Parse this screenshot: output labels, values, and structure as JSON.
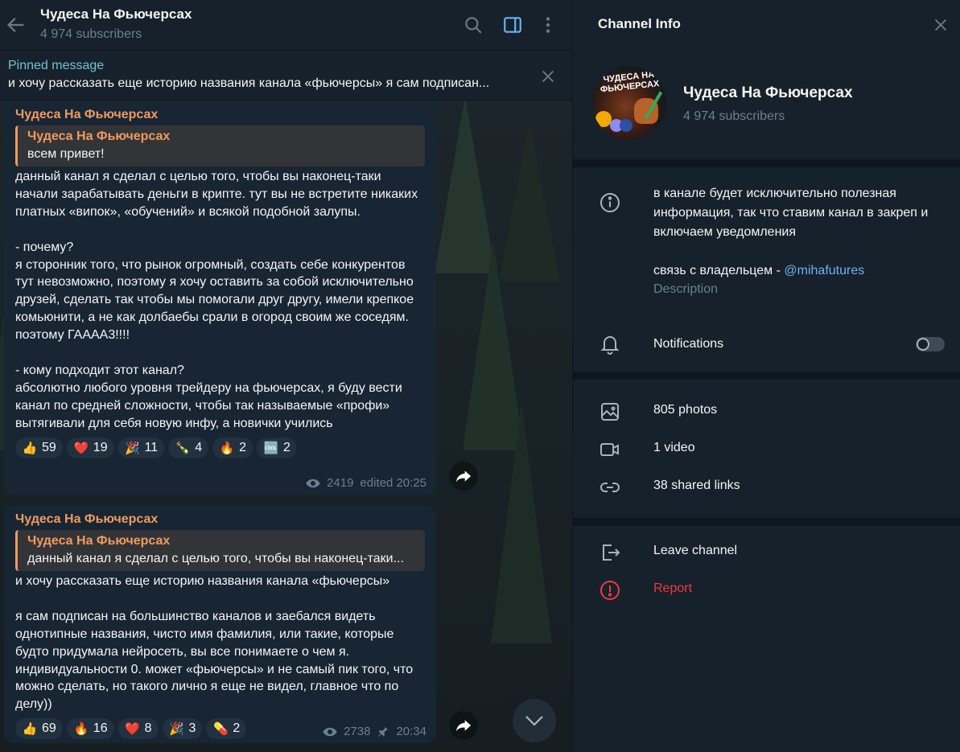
{
  "header": {
    "title": "Чудеса На Фьючерсах",
    "subtitle": "4 974 subscribers"
  },
  "pinned": {
    "label": "Pinned message",
    "text": "и хочу рассказать еще историю названия канала «фьючерсы»  я сам подписан..."
  },
  "messages": [
    {
      "author": "Чудеса На Фьючерсах",
      "reply_author": "Чудеса На Фьючерсах",
      "reply_text": "всем привет!",
      "text": "данный канал я сделал с целью того, чтобы вы наконец-таки начали зарабатывать деньги в крипте. тут вы не встретите никаких платных «випок», «обучений» и всякой подобной залупы.\n\n- почему?\nя сторонник того, что рынок огромный, создать себе конкурентов тут невозможно, поэтому я хочу оставить за собой исключительно друзей, сделать так чтобы мы помогали друг другу, имели крепкое комьюнити, а не как долбаебы срали в огород своим же соседям. поэтому ГАААА3!!!!\n\n- кому подходит этот канал?\nабсолютно любого уровня трейдеру на фьючерсах, я буду вести канал по средней сложности, чтобы так называемые «профи» вытягивали для себя новую инфу, а новички учились",
      "reactions": [
        {
          "emoji": "👍",
          "count": "59"
        },
        {
          "emoji": "❤️",
          "count": "19"
        },
        {
          "emoji": "🎉",
          "count": "11"
        },
        {
          "emoji": "🍾",
          "count": "4"
        },
        {
          "emoji": "🔥",
          "count": "2"
        },
        {
          "emoji": "🆒",
          "count": "2"
        }
      ],
      "views": "2419",
      "time": "edited 20:25"
    },
    {
      "author": "Чудеса На Фьючерсах",
      "reply_author": "Чудеса На Фьючерсах",
      "reply_text": "данный канал я сделал с целью того, чтобы вы наконец-таки...",
      "text": "и хочу рассказать еще историю названия канала «фьючерсы»\n\nя сам подписан на большинство каналов и заебался видеть однотипные названия, чисто имя фамилия, или такие, которые будто придумала нейросеть, вы все понимаете о чем я. индивидуальности 0. может «фьючерсы» и не самый пик того, что можно сделать, но такого лично я еще не видел, главное что по делу))",
      "reactions": [
        {
          "emoji": "👍",
          "count": "69"
        },
        {
          "emoji": "🔥",
          "count": "16"
        },
        {
          "emoji": "❤️",
          "count": "8"
        },
        {
          "emoji": "🎉",
          "count": "3"
        },
        {
          "emoji": "💊",
          "count": "2"
        }
      ],
      "views": "2738",
      "time": "20:34"
    }
  ],
  "info": {
    "panel_title": "Channel Info",
    "channel_name": "Чудеса На Фьючерсах",
    "subscribers": "4 974 subscribers",
    "avatar_text": "ЧУДЕСА НА ФЬЮЧЕРСАХ",
    "description_main": "в канале будет исключительно полезная информация, так что ставим канал в закреп и включаем уведомления",
    "description_contact_prefix": "связь с владельцем - ",
    "description_contact_link": "@mihafutures",
    "description_label": "Description",
    "notifications_label": "Notifications",
    "notifications_on": false,
    "photos": "805 photos",
    "videos": "1 video",
    "links": "38 shared links",
    "leave": "Leave channel",
    "report": "Report"
  },
  "colors": {
    "accent": "#6ab3f3",
    "author": "#f09a5e",
    "danger": "#ec3942",
    "panel_bg": "#17212b",
    "bubble_bg": "#182533"
  },
  "icons": [
    "back-arrow-icon",
    "search-icon",
    "sidebar-toggle-icon",
    "more-vertical-icon",
    "close-icon",
    "forward-icon",
    "chevron-down-icon",
    "info-icon",
    "bell-icon",
    "photo-icon",
    "video-icon",
    "link-icon",
    "leave-icon",
    "report-icon",
    "eye-icon",
    "pin-icon"
  ]
}
